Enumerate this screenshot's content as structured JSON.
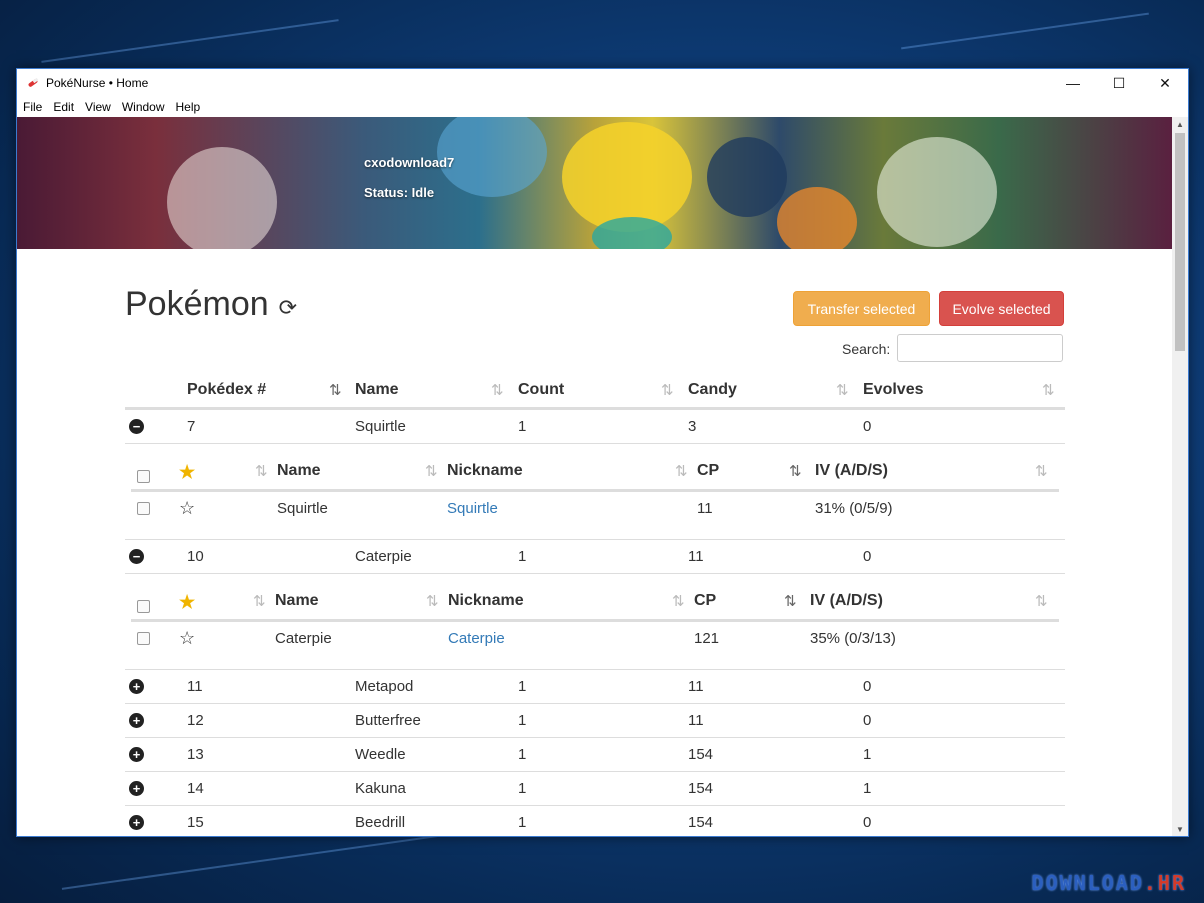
{
  "window": {
    "title": "PokéNurse • Home",
    "controls": [
      "—",
      "☐",
      "✕"
    ]
  },
  "menu": [
    "File",
    "Edit",
    "View",
    "Window",
    "Help"
  ],
  "banner": {
    "username": "cxodownload7",
    "status": "Status: Idle"
  },
  "page": {
    "title": "Pokémon"
  },
  "buttons": {
    "transfer": "Transfer selected",
    "evolve": "Evolve selected"
  },
  "search": {
    "label": "Search:",
    "placeholder": ""
  },
  "table": {
    "headers": [
      "Pokédex #",
      "Name",
      "Count",
      "Candy",
      "Evolves"
    ],
    "sub_headers": [
      "Name",
      "Nickname",
      "CP",
      "IV (A/D/S)"
    ]
  },
  "groups": [
    {
      "dex": "7",
      "name": "Squirtle",
      "count": "1",
      "candy": "3",
      "evolves": "0",
      "expanded": true,
      "detail": {
        "name": "Squirtle",
        "nickname": "Squirtle",
        "cp": "11",
        "iv": "31% (0/5/9)"
      }
    },
    {
      "dex": "10",
      "name": "Caterpie",
      "count": "1",
      "candy": "11",
      "evolves": "0",
      "expanded": true,
      "detail": {
        "name": "Caterpie",
        "nickname": "Caterpie",
        "cp": "121",
        "iv": "35% (0/3/13)"
      }
    },
    {
      "dex": "11",
      "name": "Metapod",
      "count": "1",
      "candy": "11",
      "evolves": "0",
      "expanded": false
    },
    {
      "dex": "12",
      "name": "Butterfree",
      "count": "1",
      "candy": "11",
      "evolves": "0",
      "expanded": false
    },
    {
      "dex": "13",
      "name": "Weedle",
      "count": "1",
      "candy": "154",
      "evolves": "1",
      "expanded": false
    },
    {
      "dex": "14",
      "name": "Kakuna",
      "count": "1",
      "candy": "154",
      "evolves": "1",
      "expanded": false
    },
    {
      "dex": "15",
      "name": "Beedrill",
      "count": "1",
      "candy": "154",
      "evolves": "0",
      "expanded": false
    }
  ],
  "watermark": {
    "main": "DOWNLOAD",
    "suffix": ".HR"
  }
}
